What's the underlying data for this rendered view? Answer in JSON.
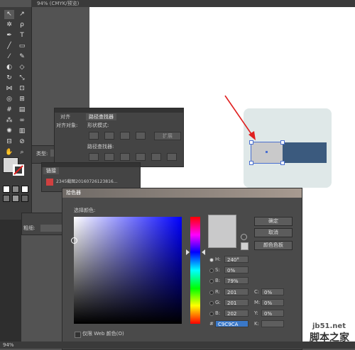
{
  "document": {
    "tab_title": "94% (CMYK/预览)"
  },
  "panels": {
    "align_tabs": [
      "对齐",
      "路径查找器"
    ],
    "align_label": "对齐对象:",
    "shape_modes_label": "形状模式:",
    "pathfinders_label": "路径查找器:",
    "expand_button": "扩展",
    "type_label": "类型:",
    "links_tab": "链接",
    "link_filename": "2345截图20160726123816...",
    "weight_label": "粗细:"
  },
  "color_picker": {
    "title": "拾色器",
    "select_color_label": "选择颜色:",
    "buttons": {
      "ok": "确定",
      "cancel": "取消",
      "swatches": "颜色色板"
    },
    "fields": {
      "H": {
        "label": "H:",
        "value": "240°"
      },
      "S": {
        "label": "S:",
        "value": "0%"
      },
      "B": {
        "label": "B:",
        "value": "79%"
      },
      "R": {
        "label": "R:",
        "value": "201"
      },
      "G": {
        "label": "G:",
        "value": "201"
      },
      "Bb": {
        "label": "B:",
        "value": "202"
      },
      "C": {
        "label": "C:",
        "value": "0%"
      },
      "M": {
        "label": "M:",
        "value": "0%"
      },
      "Y": {
        "label": "Y:",
        "value": "0%"
      },
      "K": {
        "label": "K:"
      },
      "hex": {
        "label": "#",
        "value": "C9C9CA"
      }
    },
    "web_only_label": "仅限 Web 颜色(O)",
    "current_color": "#c9c9ca"
  },
  "status": {
    "zoom": "94%"
  },
  "artwork": {
    "bg": "#dfe8e8",
    "gray_rect": "#c9c9ca",
    "blue_rect": "#3b5a7e",
    "arrow_color": "#e02020"
  },
  "watermark": {
    "site": "jb51.net",
    "name": "脚本之家"
  }
}
